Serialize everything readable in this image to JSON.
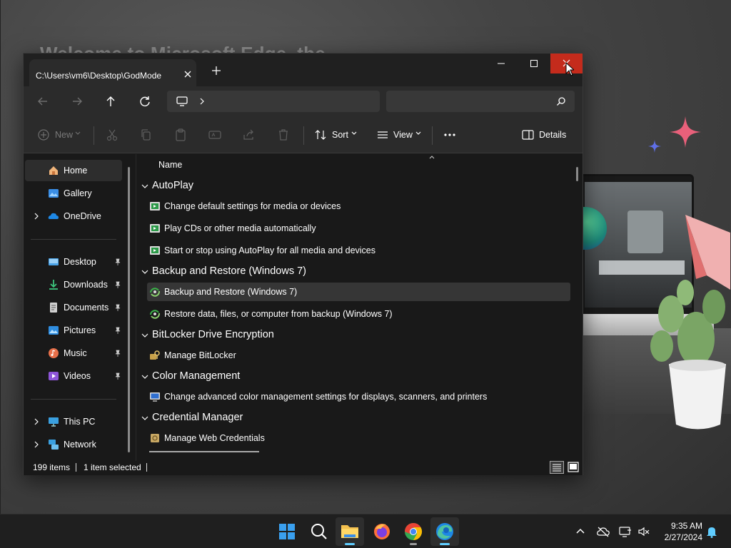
{
  "background": {
    "edge_welcome": "Welcome to Microsoft Edge, the"
  },
  "window": {
    "tab_title": "C:\\Users\\vm6\\Desktop\\GodMode",
    "new_tab_icon": "plus-icon",
    "close_color": "#c42b1c"
  },
  "commandbar": {
    "new_label": "New",
    "sort_label": "Sort",
    "view_label": "View",
    "details_label": "Details"
  },
  "sidebar": {
    "items": [
      {
        "label": "Home",
        "icon": "home-icon"
      },
      {
        "label": "Gallery",
        "icon": "gallery-icon"
      },
      {
        "label": "OneDrive",
        "icon": "onedrive-icon"
      },
      {
        "label": "Desktop",
        "icon": "desktop-icon"
      },
      {
        "label": "Downloads",
        "icon": "downloads-icon"
      },
      {
        "label": "Documents",
        "icon": "documents-icon"
      },
      {
        "label": "Pictures",
        "icon": "pictures-icon"
      },
      {
        "label": "Music",
        "icon": "music-icon"
      },
      {
        "label": "Videos",
        "icon": "videos-icon"
      },
      {
        "label": "This PC",
        "icon": "this-pc-icon"
      },
      {
        "label": "Network",
        "icon": "network-icon"
      }
    ]
  },
  "content": {
    "column_name": "Name",
    "groups": [
      {
        "label": "AutoPlay",
        "items": [
          "Change default settings for media or devices",
          "Play CDs or other media automatically",
          "Start or stop using AutoPlay for all media and devices"
        ]
      },
      {
        "label": "Backup and Restore (Windows 7)",
        "items": [
          "Backup and Restore (Windows 7)",
          "Restore data, files, or computer from backup (Windows 7)"
        ]
      },
      {
        "label": "BitLocker Drive Encryption",
        "items": [
          "Manage BitLocker"
        ]
      },
      {
        "label": "Color Management",
        "items": [
          "Change advanced color management settings for displays, scanners, and printers"
        ]
      },
      {
        "label": "Credential Manager",
        "items": [
          "Manage Web Credentials"
        ]
      }
    ]
  },
  "status": {
    "item_count": "199 items",
    "selection": "1 item selected"
  },
  "taskbar": {
    "time": "9:35 AM",
    "date": "2/27/2024",
    "accent": "#60cdff"
  }
}
